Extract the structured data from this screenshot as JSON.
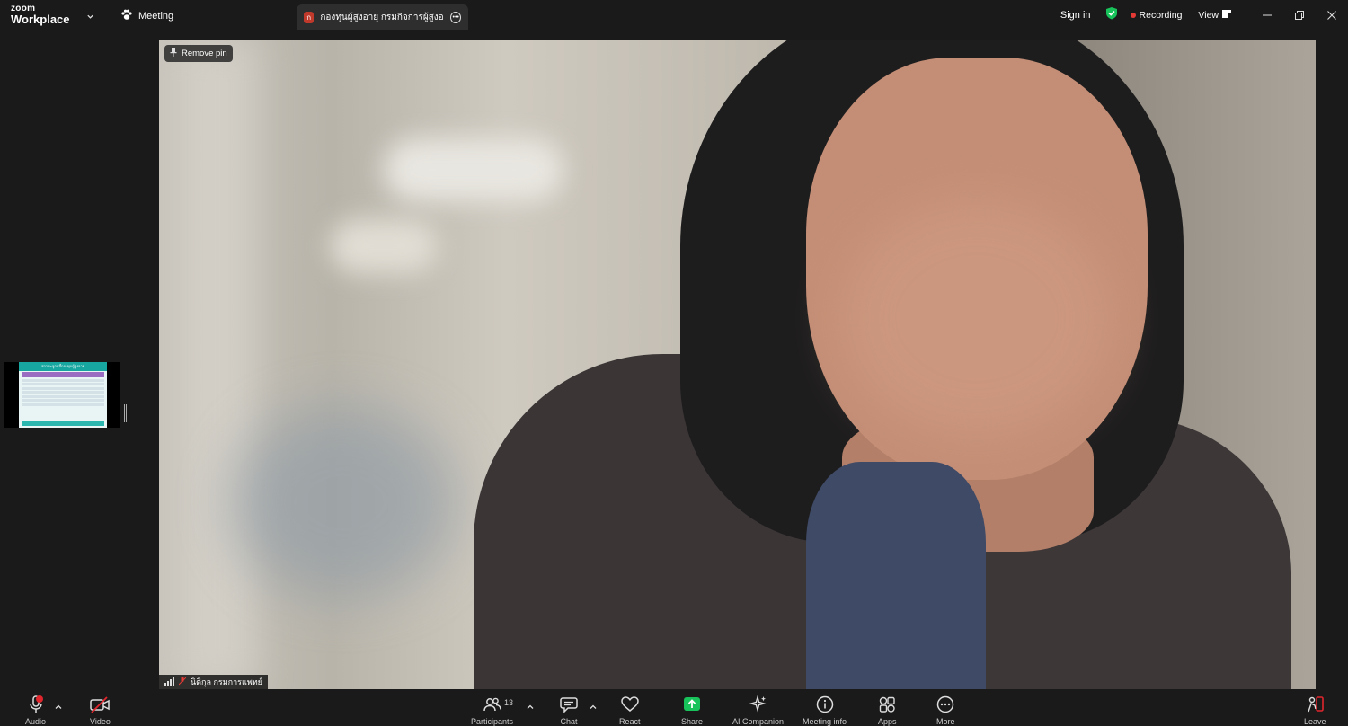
{
  "app": {
    "brand_top": "zoom",
    "brand_bottom": "Workplace"
  },
  "tabs": {
    "meeting": "Meeting",
    "shared": {
      "badge": "ก",
      "title": "กองทุนผู้สูงอายุ กรมกิจการผู้สูงอายุ's sc"
    }
  },
  "header": {
    "sign_in": "Sign in",
    "recording": "Recording",
    "view": "View"
  },
  "video": {
    "remove_pin": "Remove pin",
    "participant_name": "นิติกุล กรมการแพทย์"
  },
  "thumbnail": {
    "slide_title": "สถานะลูกหนี้กองทุนผู้สูงอายุ"
  },
  "toolbar": {
    "audio": "Audio",
    "video": "Video",
    "participants": "Participants",
    "participants_count": "13",
    "chat": "Chat",
    "react": "React",
    "share": "Share",
    "ai_companion": "AI Companion",
    "meeting_info": "Meeting info",
    "apps": "Apps",
    "more": "More",
    "leave": "Leave"
  },
  "colors": {
    "accent_green": "#17c35a",
    "record_red": "#e53935",
    "leave_red": "#e0252d"
  }
}
